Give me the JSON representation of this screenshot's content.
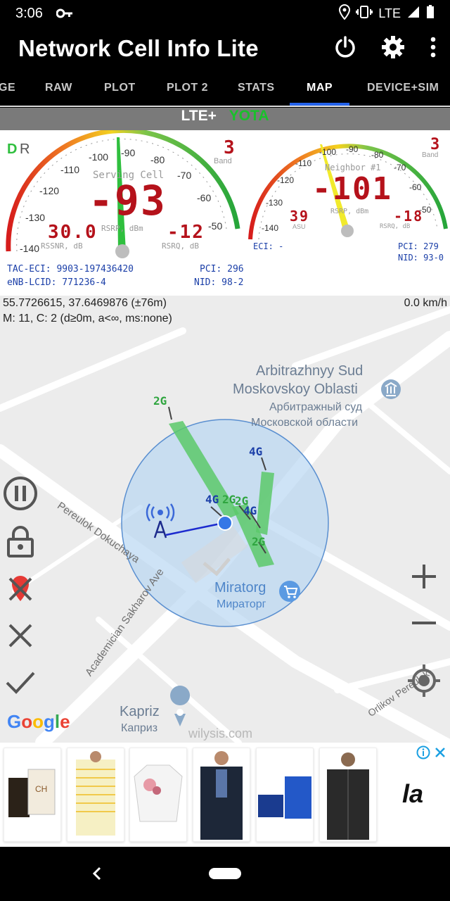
{
  "status": {
    "time": "3:06",
    "network": "LTE"
  },
  "app": {
    "title": "Network Cell Info Lite"
  },
  "tabs": [
    {
      "label": "GE"
    },
    {
      "label": "RAW"
    },
    {
      "label": "PLOT"
    },
    {
      "label": "PLOT 2"
    },
    {
      "label": "STATS"
    },
    {
      "label": "MAP"
    },
    {
      "label": "DEVICE+SIM"
    }
  ],
  "network": {
    "tech": "LTE+",
    "operator": "YOTA"
  },
  "serving": {
    "mode_d": "D",
    "mode_r": "R",
    "title": "Serving Cell",
    "rsrp": "-93",
    "rsrp_label": "RSRP, dBm",
    "band": "3",
    "band_label": "Band",
    "rssnr": "30.0",
    "rssnr_label": "RSSNR, dB",
    "rsrq": "-12",
    "rsrq_label": "RSRQ, dB",
    "ticks": [
      "-140",
      "-130",
      "-120",
      "-110",
      "-100",
      "-90",
      "-80",
      "-70",
      "-60",
      "-50"
    ],
    "tac_eci": "TAC-ECI: 9903-197436420",
    "enb_lcid": "eNB-LCID: 771236-4",
    "pci": "PCI: 296",
    "nid": "NID: 98-2"
  },
  "neighbor": {
    "title": "Neighbor #1",
    "rsrp": "-101",
    "rsrp_label": "RSRP, dBm",
    "band": "3",
    "band_label": "Band",
    "asu": "39",
    "asu_label": "ASU",
    "rsrq": "-18",
    "rsrq_label": "RSRQ, dB",
    "ticks": [
      "-140",
      "-130",
      "-120",
      "-110",
      "-100",
      "-90",
      "-80",
      "-70",
      "-60",
      "-50"
    ],
    "eci": "ECI: -",
    "pci": "PCI: 279",
    "nid": "NID: 93-0"
  },
  "map": {
    "coords": "55.7726615, 37.6469876 (±76m)",
    "filter": "M: 11, C: 2 (d≥0m, a<∞, ms:none)",
    "speed": "0.0 km/h",
    "poi1_en_1": "Arbitrazhnyy Sud",
    "poi1_en_2": "Moskovskoy Oblasti",
    "poi1_ru_1": "Арбитражный суд",
    "poi1_ru_2": "Московской области",
    "poi2_en": "Miratorg",
    "poi2_ru": "Мираторг",
    "poi3_en": "Kapriz",
    "poi3_ru": "Каприз",
    "street1": "Pereulok Dokuchaya",
    "street2": "Academician Sakharov Ave",
    "street3": "Orlikov Pereulok",
    "watermark": "wilysis.com",
    "google": "Google",
    "cell_labels": [
      "2G",
      "4G",
      "4G",
      "2G",
      "2G",
      "4G",
      "2G"
    ]
  },
  "ad": {
    "text": "la"
  },
  "colors": {
    "accent": "#2563eb",
    "operator": "#19c12b",
    "lcd": "#b5121b",
    "sector": "#5cc96a",
    "info_blue": "#1b3fa8"
  }
}
